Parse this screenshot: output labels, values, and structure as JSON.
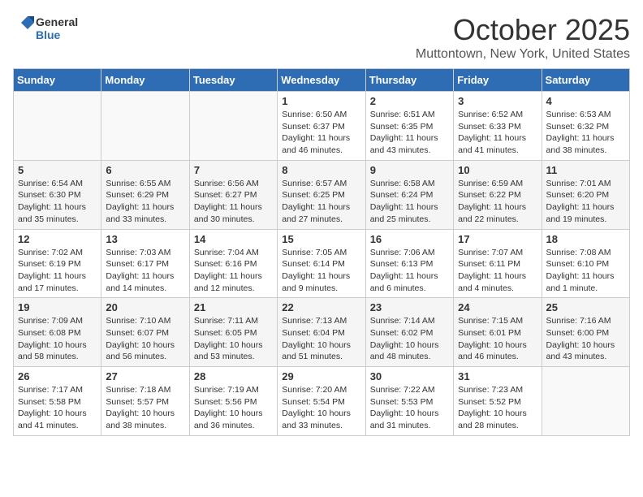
{
  "header": {
    "logo_line1": "General",
    "logo_line2": "Blue",
    "month": "October 2025",
    "location": "Muttontown, New York, United States"
  },
  "weekdays": [
    "Sunday",
    "Monday",
    "Tuesday",
    "Wednesday",
    "Thursday",
    "Friday",
    "Saturday"
  ],
  "weeks": [
    [
      {
        "day": "",
        "info": ""
      },
      {
        "day": "",
        "info": ""
      },
      {
        "day": "",
        "info": ""
      },
      {
        "day": "1",
        "info": "Sunrise: 6:50 AM\nSunset: 6:37 PM\nDaylight: 11 hours\nand 46 minutes."
      },
      {
        "day": "2",
        "info": "Sunrise: 6:51 AM\nSunset: 6:35 PM\nDaylight: 11 hours\nand 43 minutes."
      },
      {
        "day": "3",
        "info": "Sunrise: 6:52 AM\nSunset: 6:33 PM\nDaylight: 11 hours\nand 41 minutes."
      },
      {
        "day": "4",
        "info": "Sunrise: 6:53 AM\nSunset: 6:32 PM\nDaylight: 11 hours\nand 38 minutes."
      }
    ],
    [
      {
        "day": "5",
        "info": "Sunrise: 6:54 AM\nSunset: 6:30 PM\nDaylight: 11 hours\nand 35 minutes."
      },
      {
        "day": "6",
        "info": "Sunrise: 6:55 AM\nSunset: 6:29 PM\nDaylight: 11 hours\nand 33 minutes."
      },
      {
        "day": "7",
        "info": "Sunrise: 6:56 AM\nSunset: 6:27 PM\nDaylight: 11 hours\nand 30 minutes."
      },
      {
        "day": "8",
        "info": "Sunrise: 6:57 AM\nSunset: 6:25 PM\nDaylight: 11 hours\nand 27 minutes."
      },
      {
        "day": "9",
        "info": "Sunrise: 6:58 AM\nSunset: 6:24 PM\nDaylight: 11 hours\nand 25 minutes."
      },
      {
        "day": "10",
        "info": "Sunrise: 6:59 AM\nSunset: 6:22 PM\nDaylight: 11 hours\nand 22 minutes."
      },
      {
        "day": "11",
        "info": "Sunrise: 7:01 AM\nSunset: 6:20 PM\nDaylight: 11 hours\nand 19 minutes."
      }
    ],
    [
      {
        "day": "12",
        "info": "Sunrise: 7:02 AM\nSunset: 6:19 PM\nDaylight: 11 hours\nand 17 minutes."
      },
      {
        "day": "13",
        "info": "Sunrise: 7:03 AM\nSunset: 6:17 PM\nDaylight: 11 hours\nand 14 minutes."
      },
      {
        "day": "14",
        "info": "Sunrise: 7:04 AM\nSunset: 6:16 PM\nDaylight: 11 hours\nand 12 minutes."
      },
      {
        "day": "15",
        "info": "Sunrise: 7:05 AM\nSunset: 6:14 PM\nDaylight: 11 hours\nand 9 minutes."
      },
      {
        "day": "16",
        "info": "Sunrise: 7:06 AM\nSunset: 6:13 PM\nDaylight: 11 hours\nand 6 minutes."
      },
      {
        "day": "17",
        "info": "Sunrise: 7:07 AM\nSunset: 6:11 PM\nDaylight: 11 hours\nand 4 minutes."
      },
      {
        "day": "18",
        "info": "Sunrise: 7:08 AM\nSunset: 6:10 PM\nDaylight: 11 hours\nand 1 minute."
      }
    ],
    [
      {
        "day": "19",
        "info": "Sunrise: 7:09 AM\nSunset: 6:08 PM\nDaylight: 10 hours\nand 58 minutes."
      },
      {
        "day": "20",
        "info": "Sunrise: 7:10 AM\nSunset: 6:07 PM\nDaylight: 10 hours\nand 56 minutes."
      },
      {
        "day": "21",
        "info": "Sunrise: 7:11 AM\nSunset: 6:05 PM\nDaylight: 10 hours\nand 53 minutes."
      },
      {
        "day": "22",
        "info": "Sunrise: 7:13 AM\nSunset: 6:04 PM\nDaylight: 10 hours\nand 51 minutes."
      },
      {
        "day": "23",
        "info": "Sunrise: 7:14 AM\nSunset: 6:02 PM\nDaylight: 10 hours\nand 48 minutes."
      },
      {
        "day": "24",
        "info": "Sunrise: 7:15 AM\nSunset: 6:01 PM\nDaylight: 10 hours\nand 46 minutes."
      },
      {
        "day": "25",
        "info": "Sunrise: 7:16 AM\nSunset: 6:00 PM\nDaylight: 10 hours\nand 43 minutes."
      }
    ],
    [
      {
        "day": "26",
        "info": "Sunrise: 7:17 AM\nSunset: 5:58 PM\nDaylight: 10 hours\nand 41 minutes."
      },
      {
        "day": "27",
        "info": "Sunrise: 7:18 AM\nSunset: 5:57 PM\nDaylight: 10 hours\nand 38 minutes."
      },
      {
        "day": "28",
        "info": "Sunrise: 7:19 AM\nSunset: 5:56 PM\nDaylight: 10 hours\nand 36 minutes."
      },
      {
        "day": "29",
        "info": "Sunrise: 7:20 AM\nSunset: 5:54 PM\nDaylight: 10 hours\nand 33 minutes."
      },
      {
        "day": "30",
        "info": "Sunrise: 7:22 AM\nSunset: 5:53 PM\nDaylight: 10 hours\nand 31 minutes."
      },
      {
        "day": "31",
        "info": "Sunrise: 7:23 AM\nSunset: 5:52 PM\nDaylight: 10 hours\nand 28 minutes."
      },
      {
        "day": "",
        "info": ""
      }
    ]
  ]
}
